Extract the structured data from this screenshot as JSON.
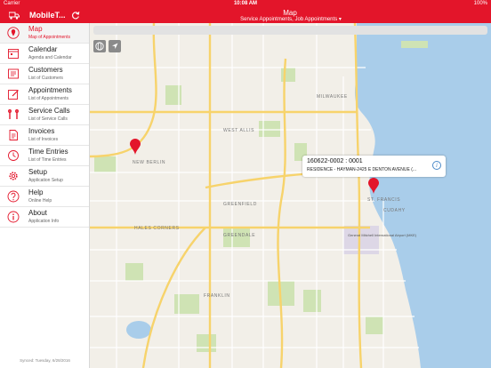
{
  "status_bar": {
    "carrier": "Carrier",
    "time": "10:08 AM",
    "battery": "100%"
  },
  "header": {
    "app_title": "MobileT...",
    "title": "Map",
    "subtitle": "Service Appointments, Job Appointments ▾"
  },
  "sidebar": {
    "items": [
      {
        "label": "Map",
        "sub": "Map of Appointments",
        "icon": "map-pin-icon"
      },
      {
        "label": "Calendar",
        "sub": "Agenda and Calendar",
        "icon": "calendar-icon"
      },
      {
        "label": "Customers",
        "sub": "List of Customers",
        "icon": "customers-icon"
      },
      {
        "label": "Appointments",
        "sub": "List of Appointments",
        "icon": "appointments-icon"
      },
      {
        "label": "Service Calls",
        "sub": "List of Service Calls",
        "icon": "tools-icon"
      },
      {
        "label": "Invoices",
        "sub": "List of Invoices",
        "icon": "invoice-icon"
      },
      {
        "label": "Time Entries",
        "sub": "List of Time Entries",
        "icon": "clock-icon"
      },
      {
        "label": "Setup",
        "sub": "Application Setup",
        "icon": "gear-icon"
      },
      {
        "label": "Help",
        "sub": "Online Help",
        "icon": "help-icon"
      },
      {
        "label": "About",
        "sub": "Application Info",
        "icon": "info-icon"
      }
    ],
    "sync_text": "Synced: Tuesday, 6/28/2016"
  },
  "map": {
    "callout_title": "160622-0002 : 0001",
    "callout_sub": "RESIDENCE - HAYMAN-2425 E DENTON AVENUE (...",
    "city_labels": {
      "milwaukee": "MILWAUKEE",
      "west_allis": "WEST ALLIS",
      "new_berlin": "NEW BERLIN",
      "greenfield": "GREENFIELD",
      "franklin": "FRANKLIN",
      "st_francis": "ST. FRANCIS",
      "cudahy": "CUDAHY",
      "greendale": "GREENDALE",
      "hales_corners": "HALES CORNERS",
      "airport": "General Mitchell International Airport (MKE)"
    },
    "colors": {
      "accent": "#e3152a",
      "road_major": "#f7d36b",
      "park": "#cfe3b4",
      "water": "#a9cdea"
    }
  }
}
